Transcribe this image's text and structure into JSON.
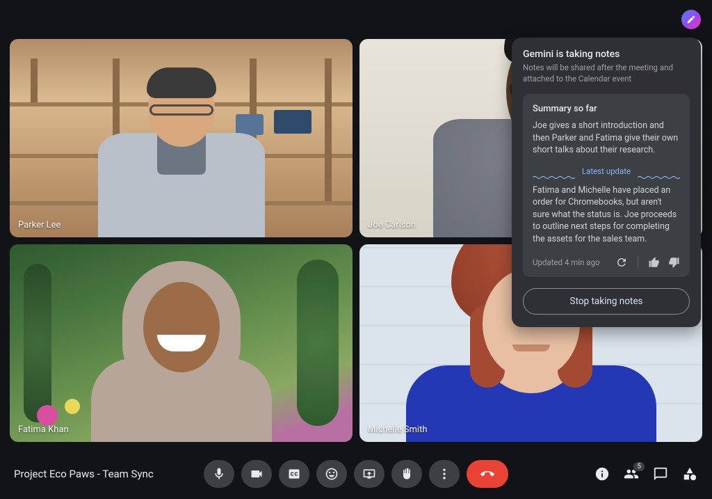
{
  "meeting_title": "Project Eco Paws - Team Sync",
  "participants": [
    {
      "name": "Parker Lee",
      "speaking": false
    },
    {
      "name": "Joe Carlson",
      "speaking": true
    },
    {
      "name": "Fatima Khan",
      "speaking": false
    },
    {
      "name": "Michelle Smith",
      "speaking": false
    }
  ],
  "people_count": "5",
  "notes_panel": {
    "title": "Gemini is taking notes",
    "subtitle": "Notes will be shared after the meeting and attached to the Calendar event",
    "summary_header": "Summary so far",
    "summary_body": "Joe gives a short introduction and then Parker and Fatima give their own short talks about their research.",
    "divider_label": "Latest update",
    "update_body": "Fatima and Michelle have placed an order for Chromebooks, but aren't sure what the status is. Joe proceeds to outline next steps for completing the assets for the sales team.",
    "updated_text": "Updated 4 min ago",
    "stop_label": "Stop taking notes"
  }
}
